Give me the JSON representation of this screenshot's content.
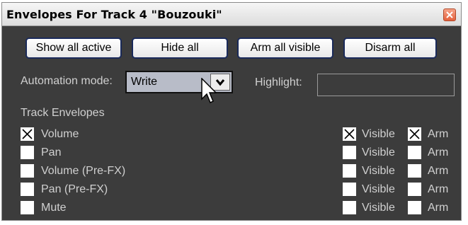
{
  "window": {
    "title": "Envelopes For Track 4 \"Bouzouki\""
  },
  "toolbar": {
    "show_all_active": "Show all active",
    "hide_all": "Hide all",
    "arm_all_visible": "Arm all visible",
    "disarm_all": "Disarm all"
  },
  "automation": {
    "label": "Automation mode:",
    "value": "Write"
  },
  "highlight": {
    "label": "Highlight:",
    "value": ""
  },
  "envelopes": {
    "section_label": "Track Envelopes",
    "visible_label": "Visible",
    "arm_label": "Arm",
    "items": [
      {
        "name": "Volume",
        "enabled": true,
        "visible": true,
        "arm": true
      },
      {
        "name": "Pan",
        "enabled": false,
        "visible": false,
        "arm": false
      },
      {
        "name": "Volume (Pre-FX)",
        "enabled": false,
        "visible": false,
        "arm": false
      },
      {
        "name": "Pan (Pre-FX)",
        "enabled": false,
        "visible": false,
        "arm": false
      },
      {
        "name": "Mute",
        "enabled": false,
        "visible": false,
        "arm": false
      }
    ]
  },
  "colors": {
    "window_bg": "#3c3c3c",
    "label_text": "#d0d0d0",
    "title_bar": "#e8e8e8",
    "close_button": "#e4603c"
  }
}
